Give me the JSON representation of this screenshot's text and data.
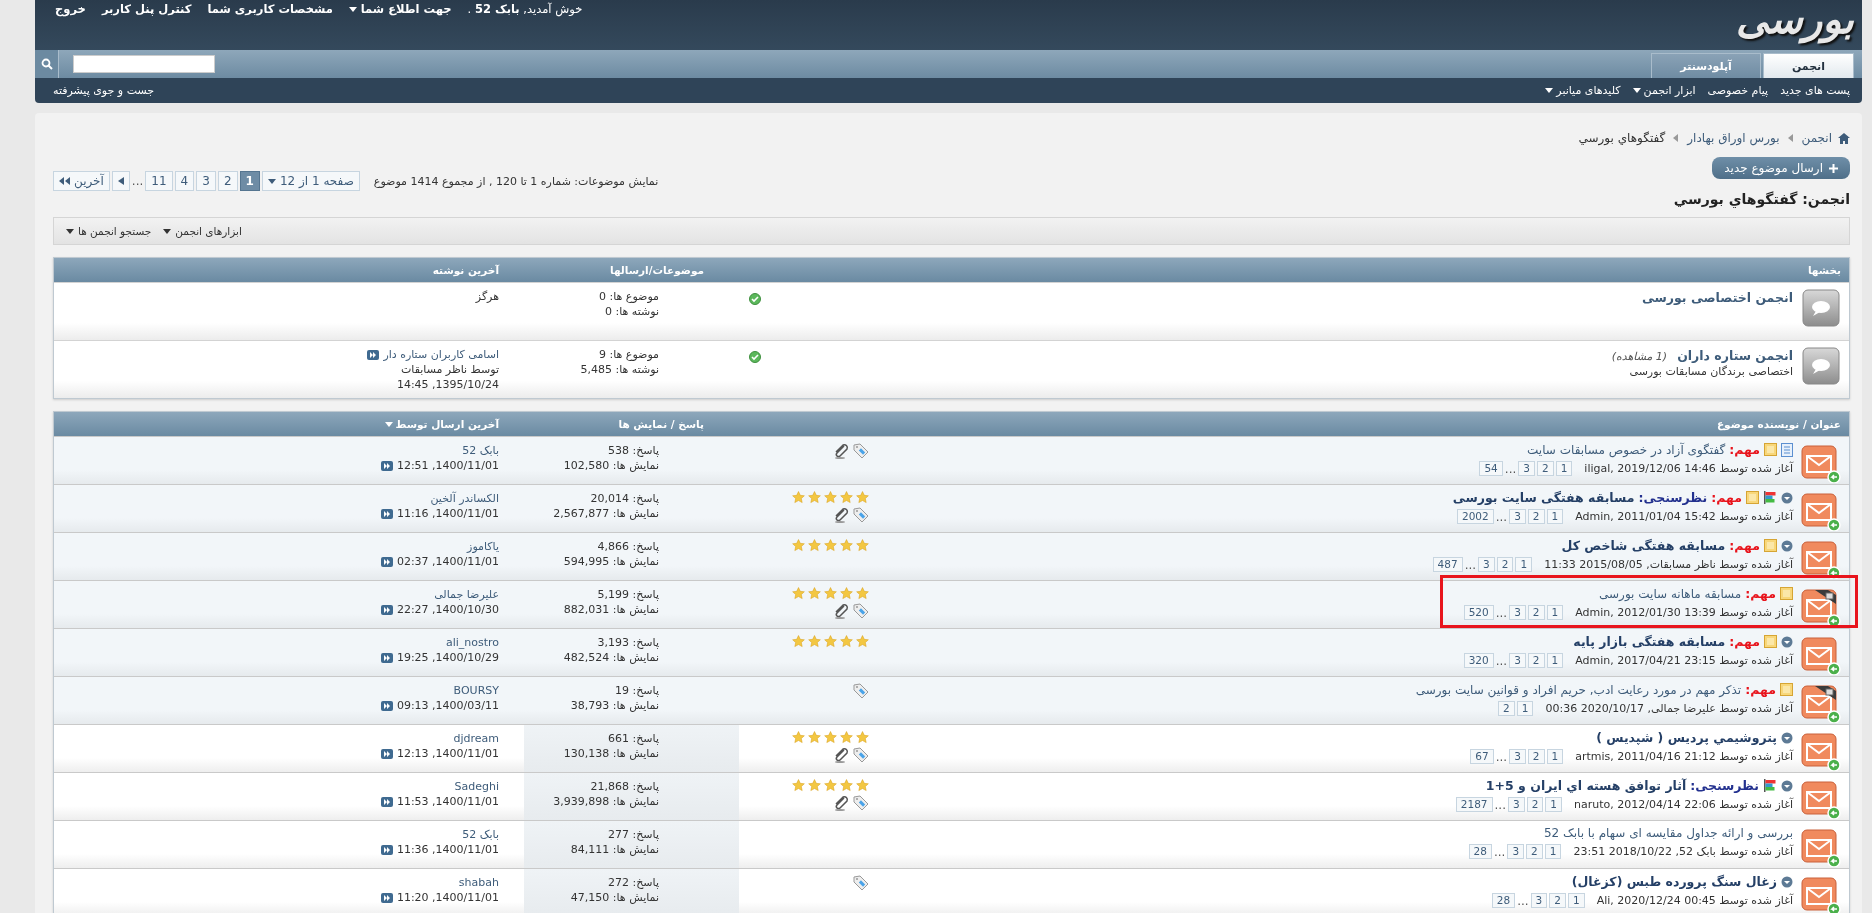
{
  "header": {
    "logo": "بورسی",
    "welcome": "خوش آمدید, **بابک 52** .",
    "links": [
      {
        "label": "جهت اطلاع شما",
        "menu": true
      },
      {
        "label": "مشخصات کاربری شما",
        "menu": false
      },
      {
        "label": "کنترل پنل کاربر",
        "menu": false
      },
      {
        "label": "خروج",
        "menu": false
      }
    ]
  },
  "tabs": [
    {
      "label": "انجمن",
      "selected": true
    },
    {
      "label": "آپلودسنتر",
      "selected": false
    }
  ],
  "subnav": {
    "items": [
      {
        "label": "پست های جدید",
        "menu": false
      },
      {
        "label": "پیام خصوصی",
        "menu": false
      },
      {
        "label": "ابزار انجمن",
        "menu": true
      },
      {
        "label": "کلیدهای میانبر",
        "menu": true
      }
    ],
    "advanced_search": "جست و جوی پیشرفته"
  },
  "breadcrumb": [
    "انجمن",
    "بورس اوراق بهادار",
    "گفتگوهاي بورسي"
  ],
  "new_topic": "ارسال موضوع جدید",
  "pagination": {
    "summary": "نمایش موضوعات: شماره 1 تا 120 , از مجموع 1414 موضوع",
    "page_menu": "صفحه 1 از 12",
    "pages": [
      {
        "label": "1",
        "selected": true
      },
      {
        "label": "2",
        "selected": false
      },
      {
        "label": "3",
        "selected": false
      },
      {
        "label": "4",
        "selected": false
      },
      {
        "label": "11",
        "selected": false
      }
    ],
    "gap": "...",
    "last": "آخرین"
  },
  "forum_title": "انجمن: گفتگوهاي بورسي",
  "tools": [
    {
      "label": "ابزارهای انجمن",
      "menu": true
    },
    {
      "label": "جستجو انجمن ها",
      "menu": true
    }
  ],
  "subforums": {
    "columns": [
      "بخشها",
      "موضوعات/ارسالها",
      "آخرین نوشته"
    ],
    "rows": [
      {
        "title": "انجمن اختصاصی بورسی",
        "stats": [
          "موضوع ها: 0",
          "نوشته ها: 0"
        ],
        "last_post": [
          "هرگز"
        ]
      },
      {
        "title": "انجمن ستاره داران",
        "viewers": "(1 مشاهده)",
        "description": "اختصاصی برندگان مسابقات بورسی",
        "stats": [
          "موضوع ها: 9",
          "نوشته ها: 5,485"
        ],
        "last_post": [
          "اسامی کاربران ستاره دار",
          "توسط ناظر مسابقات",
          "1395/10/24, 14:45"
        ]
      }
    ]
  },
  "topics": {
    "columns": [
      "عنوان / نویسنده موضوع",
      "پاسخ / نمایش ها",
      "آخرین ارسال توسط"
    ],
    "rows": [
      {
        "sticky": true,
        "locked": false,
        "unread": false,
        "document": true,
        "poll": false,
        "highlighted": false,
        "prefixes": [
          {
            "text": "مهم:",
            "kind": "sticky"
          }
        ],
        "title": "گفتگوی آزاد در خصوص مسابقات سایت",
        "starter": "آغاز شده توسط iligal, 2019/12/06 14:46",
        "pages": [
          {
            "label": "1",
            "kind": "page"
          },
          {
            "label": "2",
            "kind": "page"
          },
          {
            "label": "3",
            "kind": "page"
          },
          {
            "label": "...",
            "kind": "gap"
          },
          {
            "label": "54",
            "kind": "page"
          }
        ],
        "attachment": true,
        "tagged": true,
        "replies": "پاسخ: 538",
        "views": "نمایش ها: 102,580",
        "last_by": "بابک 52",
        "last_date": "1400/11/01, 12:51"
      },
      {
        "sticky": true,
        "locked": false,
        "unread": true,
        "document": false,
        "poll": true,
        "highlighted": false,
        "prefixes": [
          {
            "text": "مهم:",
            "kind": "sticky"
          },
          {
            "text": "نظرسنجی:",
            "kind": "poll"
          }
        ],
        "title": "مسابقه هفتگی سایت بورسی",
        "starter": "آغاز شده توسط Admin, 2011/01/04 15:42",
        "pages": [
          {
            "label": "1",
            "kind": "page"
          },
          {
            "label": "2",
            "kind": "page"
          },
          {
            "label": "3",
            "kind": "page"
          },
          {
            "label": "...",
            "kind": "gap"
          },
          {
            "label": "2002",
            "kind": "page"
          }
        ],
        "stars": 5,
        "attachment": true,
        "tagged": true,
        "replies": "پاسخ: 20,014",
        "views": "نمایش ها: 2,567,877",
        "last_by": "الکساندر آلخین",
        "last_date": "1400/11/01, 11:16"
      },
      {
        "sticky": true,
        "locked": false,
        "unread": true,
        "document": false,
        "poll": false,
        "highlighted": false,
        "prefixes": [
          {
            "text": "مهم:",
            "kind": "sticky"
          }
        ],
        "title": "مسابقه هفتگی شاخص کل",
        "starter": "آغاز شده توسط ناظر مسابقات, 2015/08/05 11:33",
        "pages": [
          {
            "label": "1",
            "kind": "page"
          },
          {
            "label": "2",
            "kind": "page"
          },
          {
            "label": "3",
            "kind": "page"
          },
          {
            "label": "...",
            "kind": "gap"
          },
          {
            "label": "487",
            "kind": "page"
          }
        ],
        "stars": 5,
        "attachment": false,
        "tagged": false,
        "replies": "پاسخ: 4,866",
        "views": "نمایش ها: 594,995",
        "last_by": "یاکاموز",
        "last_date": "1400/11/01, 02:37"
      },
      {
        "sticky": true,
        "locked": true,
        "unread": false,
        "document": false,
        "poll": false,
        "highlighted": true,
        "prefixes": [
          {
            "text": "مهم:",
            "kind": "sticky"
          }
        ],
        "title": "مسابقه ماهانه سایت بورسی",
        "starter": "آغاز شده توسط Admin, 2012/01/30 13:39",
        "pages": [
          {
            "label": "1",
            "kind": "page"
          },
          {
            "label": "2",
            "kind": "page"
          },
          {
            "label": "3",
            "kind": "page"
          },
          {
            "label": "...",
            "kind": "gap"
          },
          {
            "label": "520",
            "kind": "page"
          }
        ],
        "stars": 5,
        "attachment": true,
        "tagged": true,
        "replies": "پاسخ: 5,199",
        "views": "نمایش ها: 882,031",
        "last_by": "علیرضا جمالی",
        "last_date": "1400/10/30, 22:27"
      },
      {
        "sticky": true,
        "locked": false,
        "unread": true,
        "document": false,
        "poll": false,
        "highlighted": false,
        "prefixes": [
          {
            "text": "مهم:",
            "kind": "sticky"
          }
        ],
        "title": "مسابقه هفتگی بازار پایه",
        "starter": "آغاز شده توسط Admin, 2017/04/21 23:15",
        "pages": [
          {
            "label": "1",
            "kind": "page"
          },
          {
            "label": "2",
            "kind": "page"
          },
          {
            "label": "3",
            "kind": "page"
          },
          {
            "label": "...",
            "kind": "gap"
          },
          {
            "label": "320",
            "kind": "page"
          }
        ],
        "stars": 5,
        "attachment": false,
        "tagged": false,
        "replies": "پاسخ: 3,193",
        "views": "نمایش ها: 482,524",
        "last_by": "ali_nostro",
        "last_date": "1400/10/29, 19:25"
      },
      {
        "sticky": true,
        "locked": true,
        "unread": false,
        "document": false,
        "poll": false,
        "highlighted": false,
        "prefixes": [
          {
            "text": "مهم:",
            "kind": "sticky"
          }
        ],
        "title": "تذکر مهم در مورد رعایت ادب, حریم افراد و قوانین سایت بورسی",
        "starter": "آغاز شده توسط علیرضا جمالی, 2020/10/17 00:36",
        "pages": [
          {
            "label": "1",
            "kind": "page"
          },
          {
            "label": "2",
            "kind": "page"
          }
        ],
        "attachment": false,
        "tagged": true,
        "replies": "پاسخ: 19",
        "views": "نمایش ها: 38,793",
        "last_by": "BOURSY",
        "last_date": "1400/03/11, 09:13"
      },
      {
        "sticky": false,
        "locked": false,
        "unread": true,
        "document": false,
        "poll": false,
        "highlighted": false,
        "prefixes": [],
        "title": "پتروشيمي پرديس ( شپديس )",
        "starter": "آغاز شده توسط artmis, 2011/04/16 21:12",
        "pages": [
          {
            "label": "1",
            "kind": "page"
          },
          {
            "label": "2",
            "kind": "page"
          },
          {
            "label": "3",
            "kind": "page"
          },
          {
            "label": "...",
            "kind": "gap"
          },
          {
            "label": "67",
            "kind": "page"
          }
        ],
        "stars": 5,
        "attachment": true,
        "tagged": true,
        "replies": "پاسخ: 661",
        "views": "نمایش ها: 130,138",
        "last_by": "djdream",
        "last_date": "1400/11/01, 12:13"
      },
      {
        "sticky": false,
        "locked": false,
        "unread": true,
        "document": false,
        "poll": true,
        "highlighted": false,
        "prefixes": [
          {
            "text": "نظرسنجی:",
            "kind": "poll"
          }
        ],
        "title": "آثار توافق هسته اي ايران و 5+1",
        "starter": "آغاز شده توسط naruto, 2012/04/14 22:06",
        "pages": [
          {
            "label": "1",
            "kind": "page"
          },
          {
            "label": "2",
            "kind": "page"
          },
          {
            "label": "3",
            "kind": "page"
          },
          {
            "label": "...",
            "kind": "gap"
          },
          {
            "label": "2187",
            "kind": "page"
          }
        ],
        "stars": 5,
        "attachment": true,
        "tagged": true,
        "replies": "پاسخ: 21,868",
        "views": "نمایش ها: 3,939,898",
        "last_by": "Sadeghi",
        "last_date": "1400/11/01, 11:53"
      },
      {
        "sticky": false,
        "locked": false,
        "unread": false,
        "document": false,
        "poll": false,
        "highlighted": false,
        "prefixes": [],
        "title": "بررسی و ارائه جداول مقایسه ای سهام با بابک 52",
        "starter": "آغاز شده توسط بابک 52, 2018/10/22 23:51",
        "pages": [
          {
            "label": "1",
            "kind": "page"
          },
          {
            "label": "2",
            "kind": "page"
          },
          {
            "label": "3",
            "kind": "page"
          },
          {
            "label": "...",
            "kind": "gap"
          },
          {
            "label": "28",
            "kind": "page"
          }
        ],
        "attachment": false,
        "tagged": false,
        "replies": "پاسخ: 277",
        "views": "نمایش ها: 84,111",
        "last_by": "بابک 52",
        "last_date": "1400/11/01, 11:36"
      },
      {
        "sticky": false,
        "locked": false,
        "unread": true,
        "document": false,
        "poll": false,
        "highlighted": false,
        "prefixes": [],
        "title": "زغال سنگ پرورده طبس (کزغال)",
        "starter": "آغاز شده توسط Ali, 2020/12/24 00:45",
        "pages": [
          {
            "label": "1",
            "kind": "page"
          },
          {
            "label": "2",
            "kind": "page"
          },
          {
            "label": "3",
            "kind": "page"
          },
          {
            "label": "...",
            "kind": "gap"
          },
          {
            "label": "28",
            "kind": "page"
          }
        ],
        "attachment": false,
        "tagged": true,
        "replies": "پاسخ: 272",
        "views": "نمایش ها: 47,150",
        "last_by": "shabah",
        "last_date": "1400/11/01, 11:20"
      }
    ]
  }
}
